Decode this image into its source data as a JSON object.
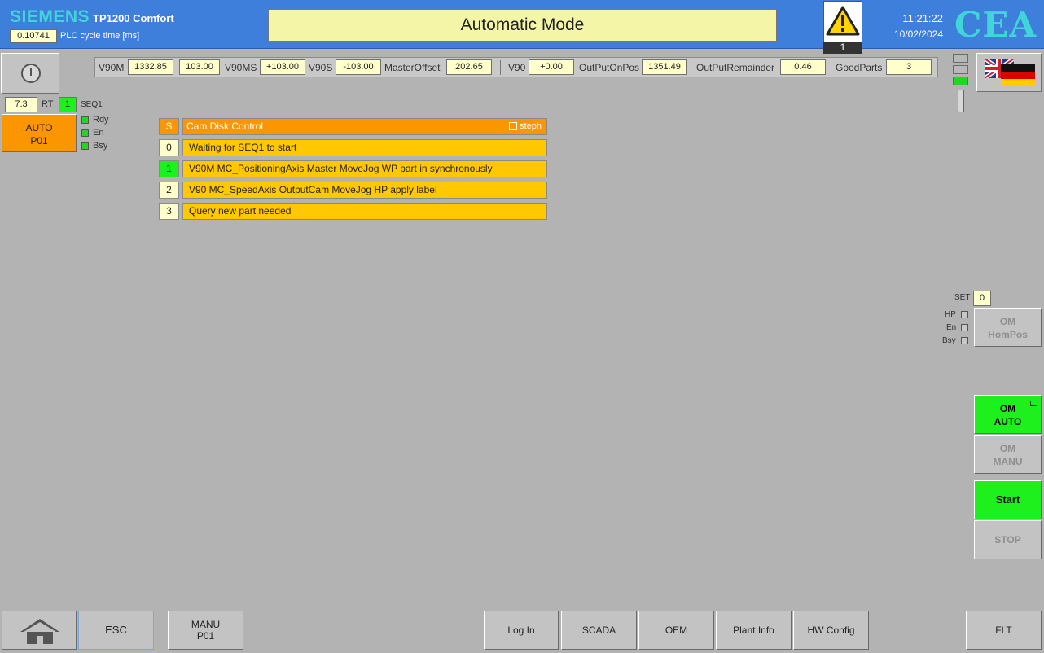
{
  "header": {
    "brand": "SIEMENS",
    "model": "TP1200 Comfort",
    "cycle_time_value": "0.10741",
    "cycle_time_label": "PLC cycle time [ms]",
    "title": "Automatic Mode",
    "alarm_count": "1",
    "time": "11:21:22",
    "date": "10/02/2024",
    "logo": "CEA"
  },
  "status": {
    "rt_value": "7.3",
    "rt_label": "RT",
    "seq_value": "1",
    "seq_label": "SEQ1",
    "auto_line1": "AUTO",
    "auto_line2": "P01",
    "leds": [
      "Rdy",
      "En",
      "Bsy"
    ]
  },
  "values": {
    "v90m_label": "V90M",
    "v90m": "1332.85",
    "v90m_2": "103.00",
    "v90ms_label": "V90MS",
    "v90ms": "+103.00",
    "v90s_label": "V90S",
    "v90s": "-103.00",
    "master_offset_label": "MasterOffset",
    "master_offset": "202.65",
    "v90_label": "V90",
    "v90": "+0.00",
    "output_on_pos_label": "OutPutOnPos",
    "output_on_pos": "1351.49",
    "output_remainder_label": "OutPutRemainder",
    "output_remainder": "0.46",
    "good_parts_label": "GoodParts",
    "good_parts": "3"
  },
  "sequence": {
    "header_num": "S",
    "header_text": "Cam Disk Control",
    "step_checkbox_label": "steph",
    "steps": [
      {
        "num": "0",
        "text": "Waiting for SEQ1 to start",
        "active": false
      },
      {
        "num": "1",
        "text": "V90M MC_PositioningAxis Master MoveJog WP part in synchronously",
        "active": true
      },
      {
        "num": "2",
        "text": "V90 MC_SpeedAxis OutputCam MoveJog HP apply label",
        "active": false
      },
      {
        "num": "3",
        "text": "Query new part needed",
        "active": false
      }
    ]
  },
  "homing": {
    "set_label": "SET",
    "set_value": "0",
    "indicators": [
      "HP",
      "En",
      "Bsy"
    ]
  },
  "side_buttons": {
    "om_hompos_1": "OM",
    "om_hompos_2": "HomPos",
    "om_auto_1": "OM",
    "om_auto_2": "AUTO",
    "om_manu_1": "OM",
    "om_manu_2": "MANU",
    "start": "Start",
    "stop": "STOP"
  },
  "bottom": {
    "esc": "ESC",
    "manu_1": "MANU",
    "manu_2": "P01",
    "login": "Log In",
    "scada": "SCADA",
    "oem": "OEM",
    "plant_info": "Plant Info",
    "hw_config": "HW Config",
    "flt": "FLT"
  },
  "icons": [
    "warning-icon",
    "power-icon",
    "uk-flag-icon",
    "germany-flag-icon",
    "home-icon"
  ],
  "colors": {
    "header_bg": "#3f7fdc",
    "auto_active": "#fb9600",
    "step_bar": "#ffc800",
    "active_green": "#1ef01e",
    "field_bg": "#ffffcc"
  }
}
